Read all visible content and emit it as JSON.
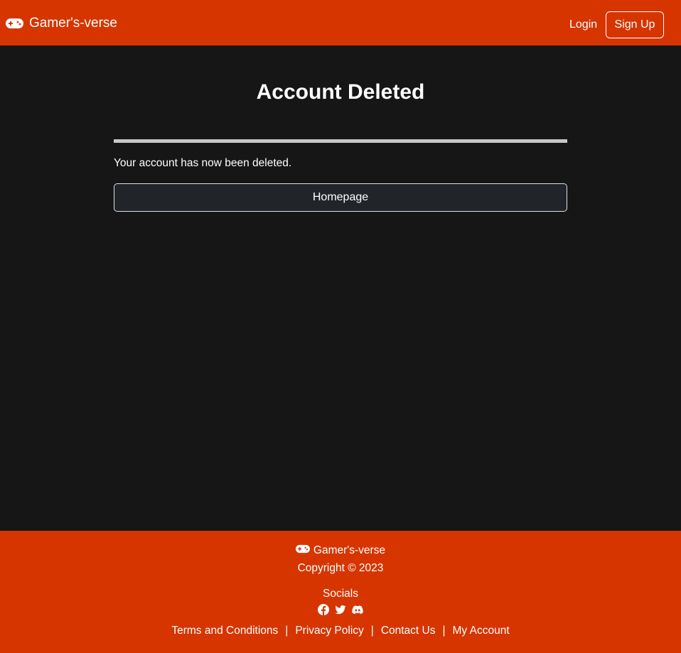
{
  "navbar": {
    "brand": "Gamer's-verse",
    "brand_icon": "gamepad-icon",
    "login_label": "Login",
    "signup_label": "Sign Up",
    "background": "#d63500"
  },
  "main": {
    "title": "Account Deleted",
    "message": "Your account has now been deleted.",
    "homepage_button": "Homepage"
  },
  "footer": {
    "brand": "Gamer's-verse",
    "brand_icon": "gamepad-icon",
    "copyright": "Copyright © 2023",
    "socials_title": "Socials",
    "socials": [
      "facebook-icon",
      "twitter-icon",
      "discord-icon"
    ],
    "links": [
      "Terms and Conditions",
      "Privacy Policy",
      "Contact Us",
      "My Account"
    ],
    "separator": "|"
  }
}
